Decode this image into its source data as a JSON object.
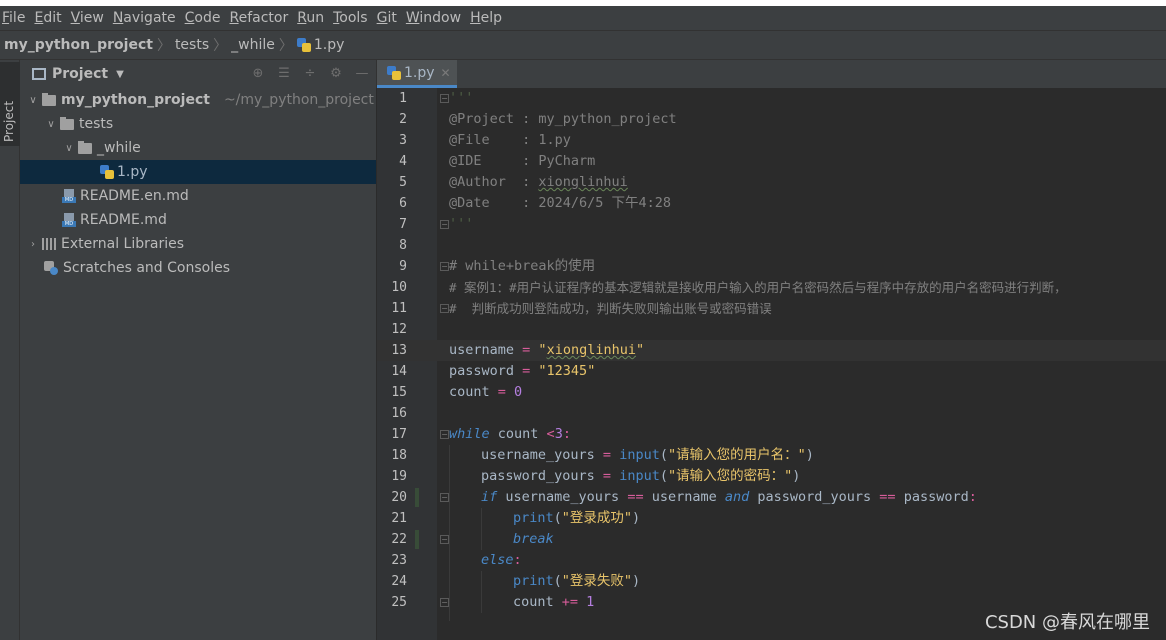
{
  "menubar": {
    "items": [
      {
        "mn": "F",
        "rest": "ile"
      },
      {
        "mn": "E",
        "rest": "dit"
      },
      {
        "mn": "V",
        "rest": "iew"
      },
      {
        "mn": "N",
        "rest": "avigate"
      },
      {
        "mn": "C",
        "rest": "ode"
      },
      {
        "mn": "R",
        "rest": "efactor"
      },
      {
        "mn": "R",
        "rest": "un"
      },
      {
        "mn": "T",
        "rest": "ools"
      },
      {
        "mn": "G",
        "rest": "it"
      },
      {
        "mn": "W",
        "rest": "indow"
      },
      {
        "mn": "H",
        "rest": "elp"
      }
    ]
  },
  "breadcrumb": {
    "project": "my_python_project",
    "folder1": "tests",
    "folder2": "_while",
    "file": "1.py"
  },
  "project_panel": {
    "title": "Project",
    "tree": {
      "root": "my_python_project",
      "root_path": "~/my_python_project",
      "tests": "tests",
      "while_folder": "_while",
      "file_1py": "1.py",
      "readme_en": "README.en.md",
      "readme": "README.md",
      "external_libraries": "External Libraries",
      "scratches": "Scratches and Consoles"
    }
  },
  "side_tab": "Project",
  "editor_tab": {
    "label": "1.py"
  },
  "code": {
    "l1": "'''",
    "l2": "@Project : my_python_project",
    "l3": "@File    : 1.py",
    "l4": "@IDE     : PyCharm",
    "l5a": "@Author  : ",
    "l5b": "xionglinhui",
    "l6": "@Date    : 2024/6/5 下午4:28",
    "l7": "'''",
    "l9": "# while+break的使用",
    "l10": "# 案例1：#用户认证程序的基本逻辑就是接收用户输入的用户名密码然后与程序中存放的用户名密码进行判断，",
    "l11": "#  判断成功则登陆成功，判断失败则输出账号或密码错误",
    "l13_var": "username",
    "l13_op": " = ",
    "l13_q1": "\"",
    "l13_val": "xionglinhui",
    "l13_q2": "\"",
    "l14_var": "password",
    "l14_op": " = ",
    "l14_str": "\"12345\"",
    "l15_var": "count",
    "l15_op": " = ",
    "l15_num": "0",
    "l17_kw": "while",
    "l17_var": " count ",
    "l17_op": "<",
    "l17_num": "3",
    "l17_colon": ":",
    "l18_var": "username_yours",
    "l18_op": " = ",
    "l18_fn": "input",
    "l18_p1": "(",
    "l18_str": "\"请输入您的用户名：\"",
    "l18_p2": ")",
    "l19_var": "password_yours",
    "l19_op": " = ",
    "l19_fn": "input",
    "l19_p1": "(",
    "l19_str": "\"请输入您的密码：\"",
    "l19_p2": ")",
    "l20_kw": "if",
    "l20_v1": " username_yours ",
    "l20_op1": "==",
    "l20_v2": " username ",
    "l20_and": "and",
    "l20_v3": " password_yours ",
    "l20_op2": "==",
    "l20_v4": " password",
    "l20_colon": ":",
    "l21_fn": "print",
    "l21_p1": "(",
    "l21_str": "\"登录成功\"",
    "l21_p2": ")",
    "l22_kw": "break",
    "l23_kw": "else",
    "l23_colon": ":",
    "l24_fn": "print",
    "l24_p1": "(",
    "l24_str": "\"登录失败\"",
    "l24_p2": ")",
    "l25_var": "count ",
    "l25_op": "+=",
    "l25_num": " 1"
  },
  "line_numbers": [
    "1",
    "2",
    "3",
    "4",
    "5",
    "6",
    "7",
    "8",
    "9",
    "10",
    "11",
    "12",
    "13",
    "14",
    "15",
    "16",
    "17",
    "18",
    "19",
    "20",
    "21",
    "22",
    "23",
    "24",
    "25"
  ],
  "watermark": "CSDN @春风在哪里",
  "colors": {
    "background": "#2b2b2b",
    "panel": "#3c3f41",
    "selection": "#0d293e",
    "accent": "#4a88c7",
    "string": "#e8c46a",
    "keyword": "#cc7832",
    "comment": "#808080",
    "docstring": "#629755"
  }
}
